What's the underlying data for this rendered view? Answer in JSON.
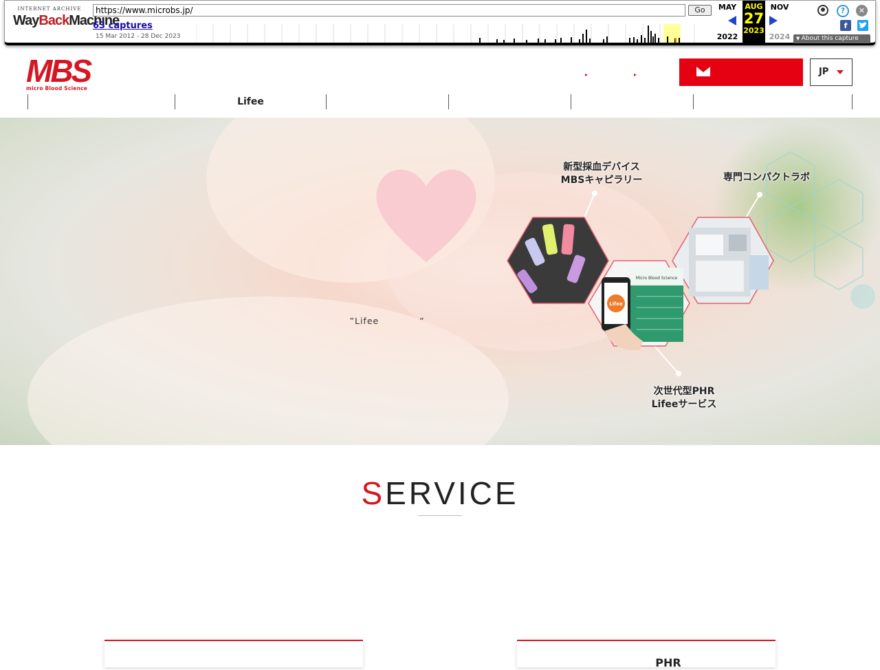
{
  "wayback": {
    "brand_top": "INTERNET ARCHIVE",
    "brand_main_a": "Way",
    "brand_main_b": "Back",
    "brand_main_c": "Machine",
    "url": "https://www.microbs.jp/",
    "go_label": "Go",
    "captures": "63 captures",
    "range": "15 Mar 2012 - 28 Dec 2023",
    "prev_month": "MAY",
    "cur_month": "AUG",
    "next_month": "NOV",
    "prev_year": "2022",
    "cur_day": "27",
    "cur_year": "2023",
    "next_year": "2024",
    "about": "About this capture",
    "help_glyph": "?",
    "close_glyph": "✕"
  },
  "header": {
    "logo_text": "MBS",
    "logo_tagline": "micro Blood Science",
    "links": [
      "　　　　　",
      "　　　　"
    ],
    "contact_label": "　　　　　　",
    "lang": "JP"
  },
  "nav": [
    "　　　　　　　　",
    "Lifee　　　　",
    "　　　　",
    "　　　　",
    "　　　　",
    "　　　　　　　　　　　"
  ],
  "hero": {
    "title": "　　　　　　　　　　　　　　　　　　　　",
    "desc_lines": [
      "　　　　　　　　　　　　　　　　　　　　　　　　　　　　　　　　　　　　　　　　　　　　　　　　",
      "　　　　　　　　　　　　　　　　　　　　　　　　　　　　　　　　　　　　　　　　　　　　　　　　　",
      "　　　　　　　　　　　　　　　　　　　　　　　　　　　　　　　”Lifee 　　　　”　　　　　　　　　　　　　"
    ],
    "labels": {
      "capillary_1": "新型採血デバイス",
      "capillary_2": "MBSキャピラリー",
      "lab": "専門コンパクトラボ",
      "phr_1": "次世代型PHR",
      "phr_2": "Lifeeサービス"
    },
    "phone_brand": "Lifee",
    "app_banner": "Micro Blood Science"
  },
  "service": {
    "title_first": "S",
    "title_rest": "ERVICE",
    "subtitle": "　　　　　　",
    "lines": [
      "　　　　　　　　　　　　　　　　　　　　　　　　　　　　　　　　　　　　　　　　　　",
      "　　　　　　　　　　　　　　　　　　　　　　　　　　　　　　　　　　　　　　　　　　　"
    ],
    "cards": [
      "　　　　　　　　",
      "　　　　PHR"
    ]
  },
  "colors": {
    "brand_red": "#d41725",
    "accent_red": "#e50012"
  }
}
